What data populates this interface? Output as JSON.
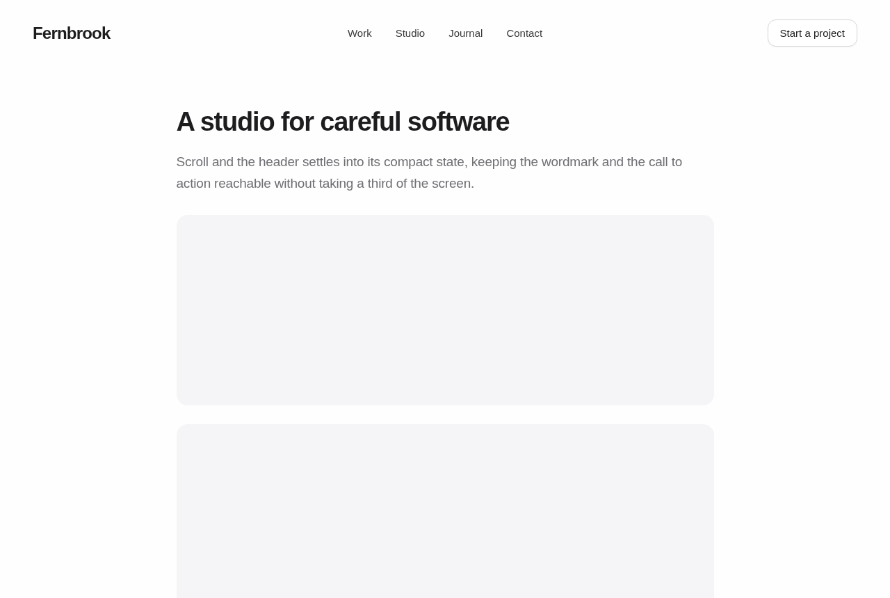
{
  "header": {
    "wordmark": "Fernbrook",
    "nav": [
      "Work",
      "Studio",
      "Journal",
      "Contact"
    ],
    "cta": "Start a project"
  },
  "hero": {
    "title": "A studio for careful software",
    "lead": "Scroll and the header settles into its compact state, keeping the wordmark and the call to action reachable without taking a third of the screen."
  },
  "cards": [
    {
      "kind": "placeholder"
    },
    {
      "kind": "placeholder"
    }
  ]
}
